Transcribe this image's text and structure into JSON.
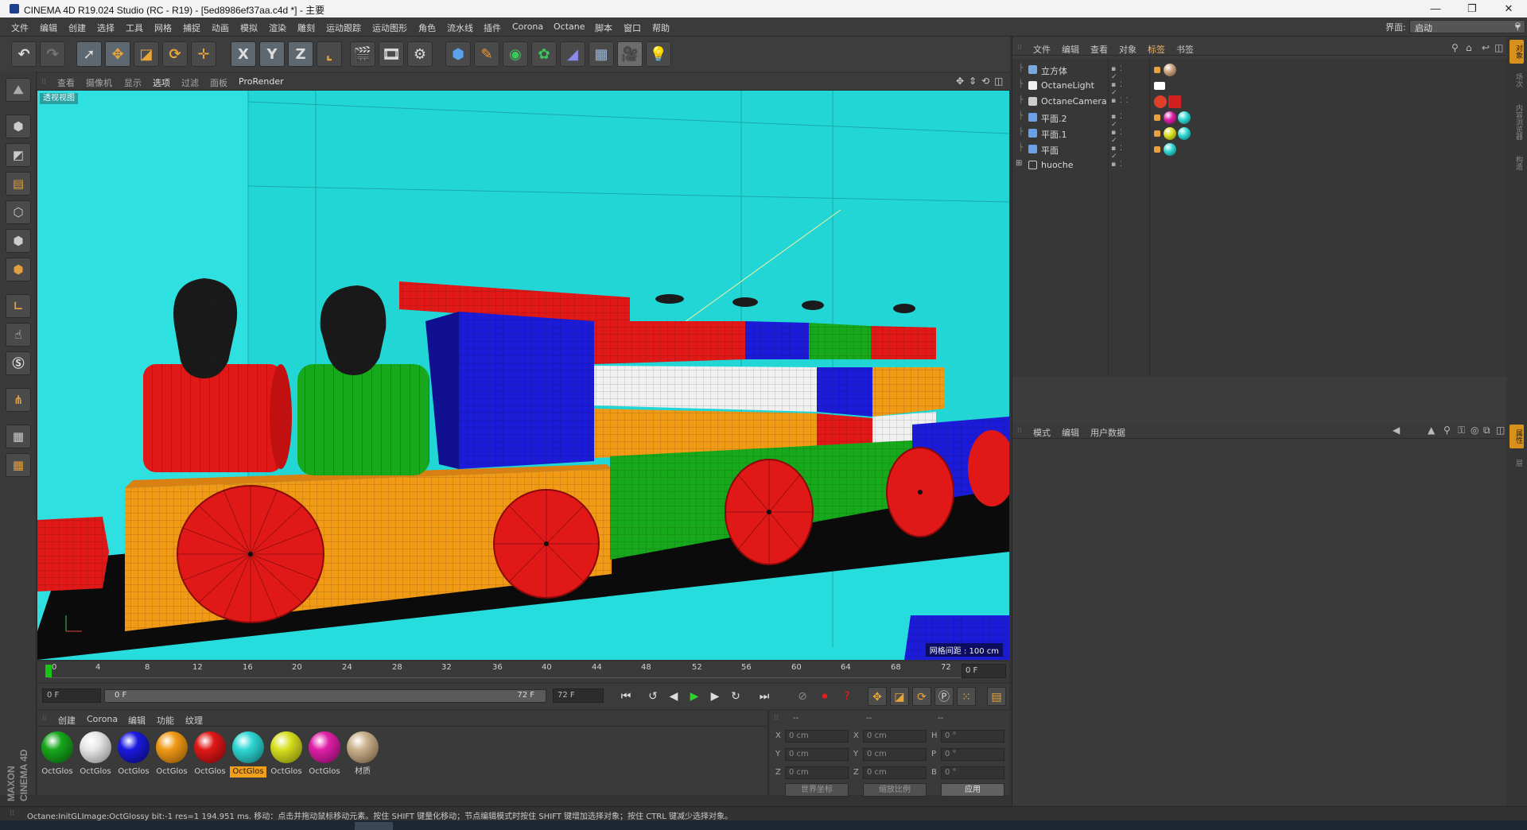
{
  "window": {
    "title": "CINEMA 4D R19.024 Studio (RC - R19) - [5ed8986ef37aa.c4d *] - 主要",
    "controls": [
      "—",
      "❐",
      "✕"
    ]
  },
  "menu": {
    "items": [
      "文件",
      "编辑",
      "创建",
      "选择",
      "工具",
      "网格",
      "捕捉",
      "动画",
      "模拟",
      "渲染",
      "雕刻",
      "运动跟踪",
      "运动图形",
      "角色",
      "流水线",
      "插件",
      "Corona",
      "Octane",
      "脚本",
      "窗口",
      "帮助"
    ],
    "interface_label": "界面:",
    "interface_value": "启动"
  },
  "toolbar": {
    "icons": [
      "undo-icon",
      "redo-icon",
      "select-arrow-icon",
      "move-icon",
      "scale-icon",
      "rotate-icon",
      "recent-tool-icon",
      "x-axis-icon",
      "y-axis-icon",
      "z-axis-icon",
      "coordinate-system-icon",
      "render-view-icon",
      "render-picture-viewer-icon",
      "render-settings-icon",
      "cube-icon",
      "pen-spline-icon",
      "subdivision-icon",
      "cloner-icon",
      "deformer-icon",
      "floor-icon",
      "camera-icon",
      "light-icon"
    ],
    "axis_letters": {
      "x": "X",
      "y": "Y",
      "z": "Z"
    }
  },
  "left_tools": [
    "make-editable-icon",
    "model-mode-icon",
    "texture-mode-icon",
    "workplane-icon",
    "point-mode-icon",
    "edge-mode-icon",
    "polygon-mode-icon",
    "axis-mode-icon",
    "tweak-icon",
    "solo-icon",
    "snap-icon",
    "lock-workplane-icon",
    "planar-workplane-icon"
  ],
  "viewport": {
    "menu": [
      "查看",
      "摄像机",
      "显示",
      "选项",
      "过滤",
      "面板",
      "ProRender"
    ],
    "active_menu": "选项",
    "label": "透视视图",
    "grid_spacing": "网格间距 : 100 cm",
    "background_color": "#27dcdc"
  },
  "timeline": {
    "ticks": [
      "0",
      "4",
      "8",
      "12",
      "16",
      "20",
      "24",
      "28",
      "32",
      "36",
      "40",
      "44",
      "48",
      "52",
      "56",
      "60",
      "64",
      "68",
      "72"
    ],
    "current_frame_display": "0 F"
  },
  "playback": {
    "start_field": "0 F",
    "slider_start": "0 F",
    "slider_end": "72 F",
    "end_field": "72 F",
    "buttons": [
      "go-start-icon",
      "prev-key-icon",
      "prev-frame-icon",
      "play-icon",
      "next-frame-icon",
      "next-key-icon",
      "go-end-icon",
      "record-icon",
      "autokey-icon",
      "keyframe-selection-icon",
      "move-key-icon",
      "scale-key-icon",
      "rotate-key-icon",
      "param-key-icon",
      "pla-key-icon",
      "timeline-window-icon"
    ]
  },
  "materials": {
    "menu": [
      "创建",
      "Corona",
      "编辑",
      "功能",
      "纹理"
    ],
    "items": [
      {
        "label": "OctGlos",
        "color": "#17a81c"
      },
      {
        "label": "OctGlos",
        "color": "#e8e8e8"
      },
      {
        "label": "OctGlos",
        "color": "#1a1ae0"
      },
      {
        "label": "OctGlos",
        "color": "#f09a16"
      },
      {
        "label": "OctGlos",
        "color": "#e01818"
      },
      {
        "label": "OctGlos",
        "color": "#30d8d4"
      },
      {
        "label": "OctGlos",
        "color": "#d8e020"
      },
      {
        "label": "OctGlos",
        "color": "#e020a8"
      },
      {
        "label": "材质",
        "color": "#cbb28e"
      }
    ],
    "selected_index": 5
  },
  "coordinates": {
    "headers": [
      "--",
      "--",
      "--"
    ],
    "rows": [
      {
        "a1": "X",
        "v1": "0 cm",
        "a2": "X",
        "v2": "0 cm",
        "a3": "H",
        "v3": "0 °"
      },
      {
        "a1": "Y",
        "v1": "0 cm",
        "a2": "Y",
        "v2": "0 cm",
        "a3": "P",
        "v3": "0 °"
      },
      {
        "a1": "Z",
        "v1": "0 cm",
        "a2": "Z",
        "v2": "0 cm",
        "a3": "B",
        "v3": "0 °"
      }
    ],
    "world_button": "世界坐标",
    "scale_button": "缩放比例",
    "apply_button": "应用"
  },
  "object_manager": {
    "menu": [
      "文件",
      "编辑",
      "查看",
      "对象",
      "标签",
      "书签"
    ],
    "active_menu": "标签",
    "objects": [
      {
        "name": "立方体",
        "icon_color": "#7aa8e0",
        "tags": [
          "#c9a27a"
        ]
      },
      {
        "name": "OctaneLight",
        "icon_color": "#f0f0f0",
        "tags": [
          "#ffffff"
        ]
      },
      {
        "name": "OctaneCamera",
        "icon_color": "#cccccc",
        "tags": [
          "#e0402a",
          "#d02020"
        ]
      },
      {
        "name": "平面.2",
        "icon_color": "#6aa0e8",
        "tags": [
          "#e020a8",
          "#30d8d4"
        ]
      },
      {
        "name": "平面.1",
        "icon_color": "#6aa0e8",
        "tags": [
          "#d8e020",
          "#30d8d4"
        ]
      },
      {
        "name": "平面",
        "icon_color": "#6aa0e8",
        "tags": [
          "#30d8d4"
        ]
      },
      {
        "name": "huoche",
        "icon_color": "#c8c8c8",
        "tags": []
      }
    ]
  },
  "attribute_manager": {
    "menu": [
      "模式",
      "编辑",
      "用户数据"
    ]
  },
  "side_tabs": [
    "对象",
    "场次",
    "内容浏览器",
    "构造",
    "属性",
    "层"
  ],
  "status": {
    "text": "Octane:InitGLImage:OctGlossy  bit:-1 res=1  194.951 ms.        移动：点击并拖动鼠标移动元素。按住 SHIFT 键量化移动；节点编辑模式时按住 SHIFT 键增加选择对象；按住 CTRL 键减少选择对象。"
  },
  "logo": {
    "text": "MAXON CINEMA 4D"
  }
}
